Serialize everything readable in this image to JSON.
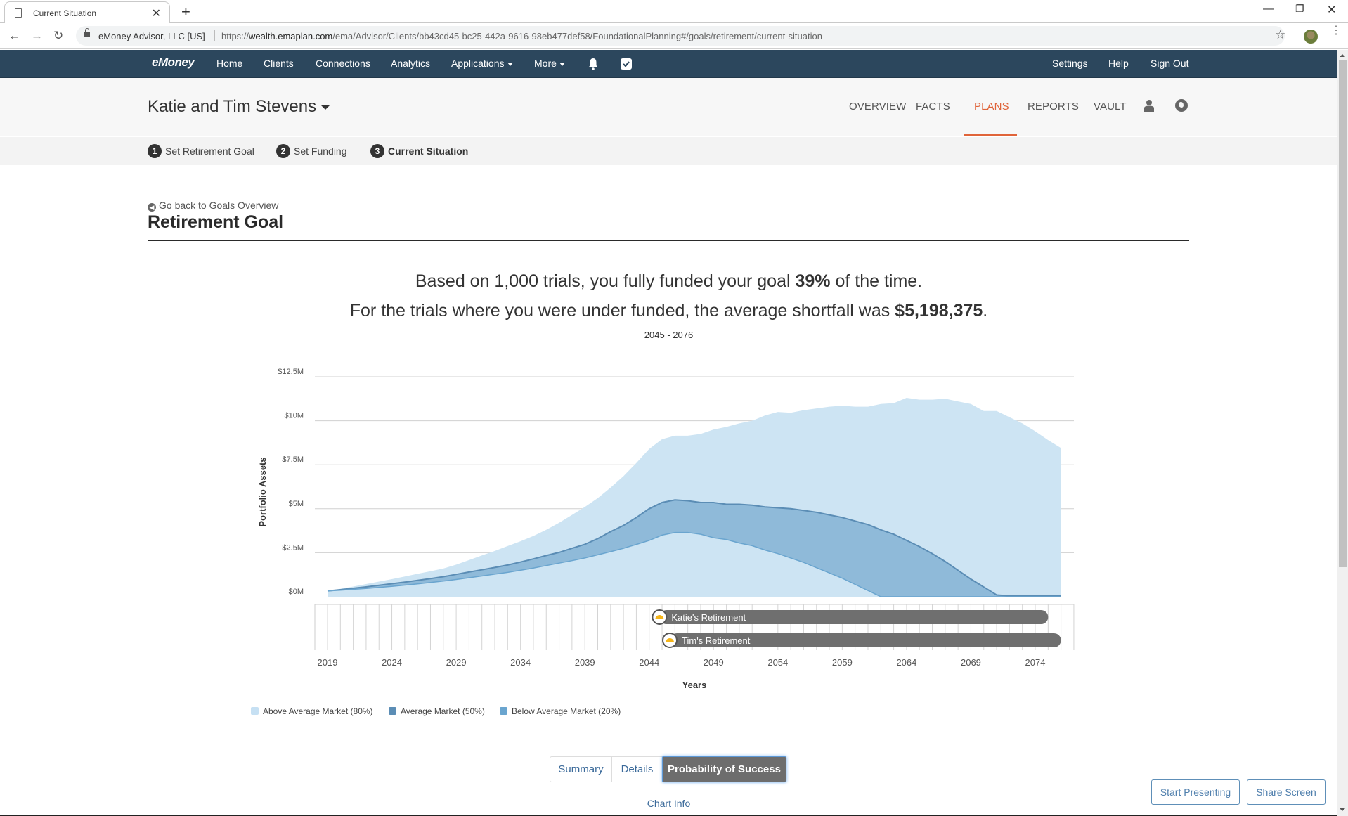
{
  "browser": {
    "tab_title": "Current Situation",
    "new_tab": "+",
    "site_identity": "eMoney Advisor, LLC [US]",
    "url_prefix": "https://",
    "url_host": "wealth.emaplan.com",
    "url_path": "/ema/Advisor/Clients/bb43cd45-bc25-442a-9616-98eb477def58/FoundationalPlanning#/goals/retirement/current-situation"
  },
  "appnav": {
    "logo": "eMoney",
    "items": [
      "Home",
      "Clients",
      "Connections",
      "Analytics",
      "Applications",
      "More"
    ],
    "right_items": [
      "Settings",
      "Help",
      "Sign Out"
    ]
  },
  "client": {
    "name": "Katie and Tim Stevens",
    "tabs": [
      "OVERVIEW",
      "FACTS",
      "PLANS",
      "REPORTS",
      "VAULT"
    ],
    "active_tab": "PLANS"
  },
  "steps": [
    {
      "num": "1",
      "label": "Set Retirement Goal"
    },
    {
      "num": "2",
      "label": "Set Funding"
    },
    {
      "num": "3",
      "label": "Current Situation"
    }
  ],
  "page": {
    "back_link": "Go back to Goals Overview",
    "title": "Retirement Goal",
    "headline1_pre": "Based on 1,000 trials, you fully funded your goal ",
    "headline1_bold": "39%",
    "headline1_post": " of the time.",
    "headline2_pre": "For the trials where you were under funded, the average shortfall was ",
    "headline2_bold": "$5,198,375",
    "headline2_post": ".",
    "date_range": "2045 - 2076"
  },
  "colors": {
    "above": "#cde4f3",
    "average": "#5b8db5",
    "below": "#6aa5cf",
    "accent": "#e0643a",
    "nav": "#2c475d"
  },
  "chart_data": {
    "type": "area",
    "title": "",
    "xlabel": "Years",
    "ylabel": "Portfolio Assets",
    "ylim": [
      0,
      12.5
    ],
    "y_unit": "$M",
    "y_ticks": [
      0,
      2.5,
      5,
      7.5,
      10,
      12.5
    ],
    "y_tick_labels": [
      "$0M",
      "$2.5M",
      "$5M",
      "$7.5M",
      "$10M",
      "$12.5M"
    ],
    "xlim": [
      2018,
      2078
    ],
    "x_ticks": [
      2019,
      2024,
      2029,
      2034,
      2039,
      2044,
      2049,
      2054,
      2059,
      2064,
      2069,
      2074
    ],
    "grid": true,
    "legend_position": "bottom-left",
    "x": [
      2019,
      2020,
      2021,
      2022,
      2023,
      2024,
      2025,
      2026,
      2027,
      2028,
      2029,
      2030,
      2031,
      2032,
      2033,
      2034,
      2035,
      2036,
      2037,
      2038,
      2039,
      2040,
      2041,
      2042,
      2043,
      2044,
      2045,
      2046,
      2047,
      2048,
      2049,
      2050,
      2051,
      2052,
      2053,
      2054,
      2055,
      2056,
      2057,
      2058,
      2059,
      2060,
      2061,
      2062,
      2063,
      2064,
      2065,
      2066,
      2067,
      2068,
      2069,
      2070,
      2071,
      2072,
      2073,
      2074,
      2075,
      2076
    ],
    "series": [
      {
        "name": "Above Average Market (80%)",
        "color": "#cde4f3",
        "values": [
          0.33,
          0.45,
          0.58,
          0.72,
          0.86,
          1.0,
          1.15,
          1.3,
          1.45,
          1.6,
          1.82,
          2.08,
          2.35,
          2.6,
          2.88,
          3.15,
          3.45,
          3.8,
          4.2,
          4.65,
          5.1,
          5.6,
          6.2,
          6.85,
          7.6,
          8.4,
          8.95,
          9.15,
          9.15,
          9.25,
          9.5,
          9.65,
          9.85,
          10.0,
          10.3,
          10.5,
          10.45,
          10.6,
          10.7,
          10.8,
          10.85,
          10.8,
          10.8,
          10.95,
          11.0,
          11.3,
          11.2,
          11.2,
          11.25,
          11.1,
          10.95,
          10.55,
          10.55,
          10.2,
          9.85,
          9.4,
          8.9,
          8.45
        ]
      },
      {
        "name": "Average Market (50%)",
        "color": "#5b8db5",
        "values": [
          0.33,
          0.4,
          0.48,
          0.56,
          0.65,
          0.74,
          0.83,
          0.93,
          1.03,
          1.14,
          1.27,
          1.4,
          1.53,
          1.66,
          1.8,
          1.97,
          2.15,
          2.34,
          2.52,
          2.75,
          2.98,
          3.3,
          3.7,
          4.05,
          4.5,
          5.0,
          5.35,
          5.5,
          5.45,
          5.35,
          5.35,
          5.25,
          5.25,
          5.2,
          5.1,
          5.05,
          5.0,
          4.9,
          4.8,
          4.65,
          4.5,
          4.3,
          4.1,
          3.8,
          3.55,
          3.2,
          2.85,
          2.45,
          2.0,
          1.5,
          1.0,
          0.55,
          0.1,
          0.05,
          0.05,
          0.04,
          0.04,
          0.04
        ]
      },
      {
        "name": "Below Average Market (20%)",
        "color": "#6aa5cf",
        "values": [
          0.33,
          0.37,
          0.42,
          0.47,
          0.53,
          0.59,
          0.66,
          0.73,
          0.81,
          0.89,
          0.98,
          1.08,
          1.18,
          1.28,
          1.38,
          1.5,
          1.63,
          1.77,
          1.91,
          2.05,
          2.2,
          2.38,
          2.56,
          2.75,
          2.97,
          3.2,
          3.5,
          3.65,
          3.65,
          3.55,
          3.35,
          3.25,
          3.05,
          2.9,
          2.65,
          2.45,
          2.2,
          1.95,
          1.65,
          1.35,
          1.05,
          0.7,
          0.35,
          0.0,
          0.0,
          0.0,
          0.0,
          0.0,
          0.0,
          0.0,
          0.0,
          0.0,
          0.0,
          0.0,
          0.0,
          0.0,
          0.0,
          0.0
        ]
      }
    ],
    "milestones": [
      {
        "label": "Katie's Retirement",
        "start": 2044.8,
        "end": 2075
      },
      {
        "label": "Tim's Retirement",
        "start": 2045.6,
        "end": 2076
      }
    ]
  },
  "legend": [
    {
      "label": "Above Average Market (80%)",
      "color": "#cde4f3"
    },
    {
      "label": "Average Market (50%)",
      "color": "#5b8db5"
    },
    {
      "label": "Below Average Market (20%)",
      "color": "#6aa5cf"
    }
  ],
  "view_toggle": {
    "options": [
      "Summary",
      "Details",
      "Probability of Success"
    ],
    "active": "Probability of Success"
  },
  "chart_info": "Chart Info",
  "actions": {
    "start_presenting": "Start Presenting",
    "share_screen": "Share Screen"
  }
}
